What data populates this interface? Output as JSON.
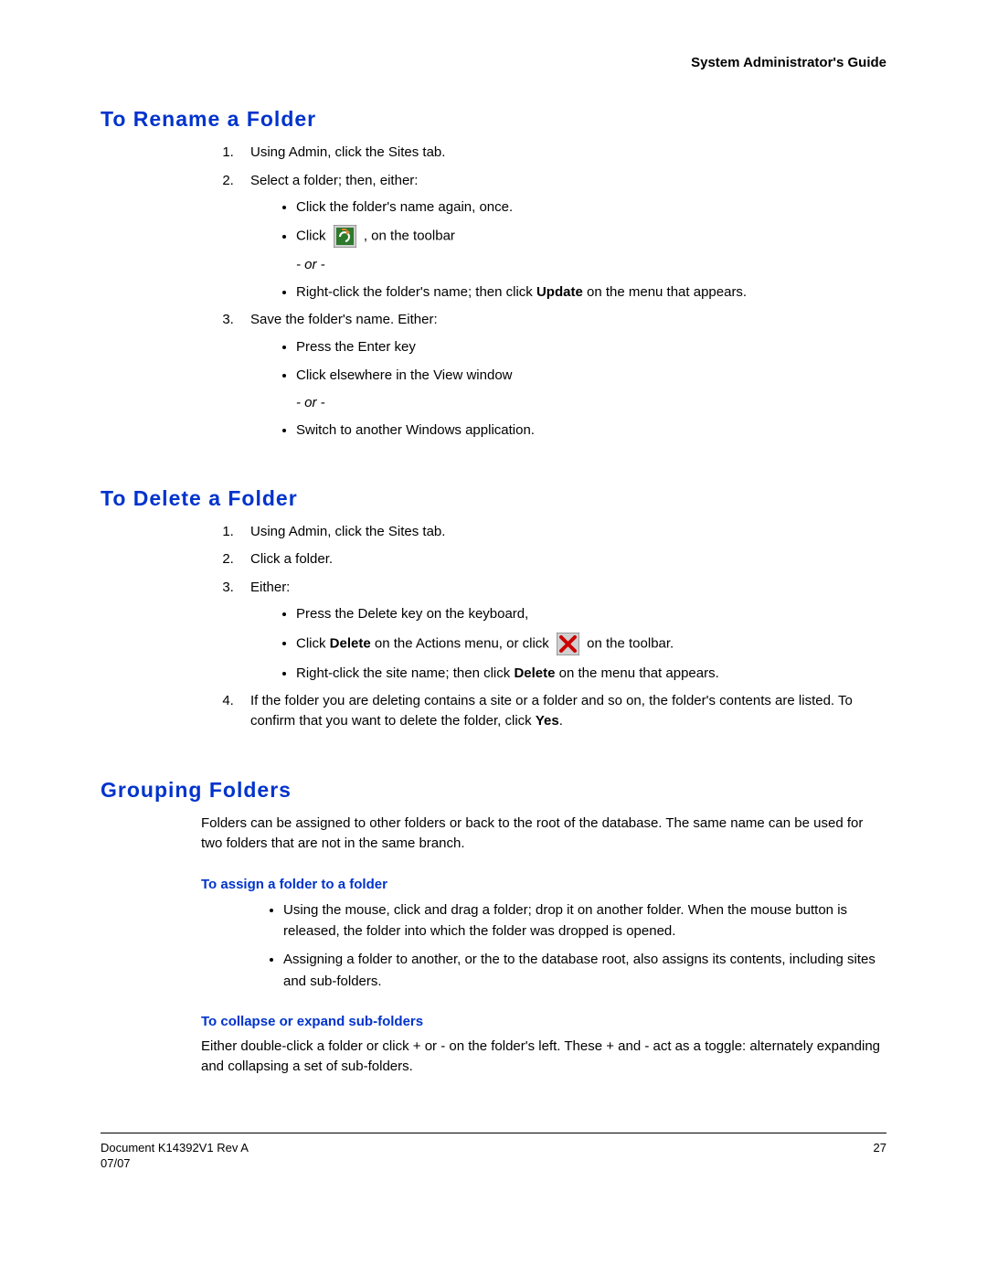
{
  "header": {
    "guide_title": "System Administrator's Guide"
  },
  "sections": {
    "rename": {
      "heading": "To Rename a Folder",
      "step1": "Using Admin, click the Sites tab.",
      "step2": "Select a folder; then, either:",
      "step2_b1": "Click the folder's name again, once.",
      "step2_b2_pre": "Click ",
      "step2_b2_post": " , on the toolbar",
      "step2_or": "- or -",
      "step2_b3_pre": "Right-click the folder's name; then click ",
      "step2_b3_bold": "Update",
      "step2_b3_post": " on the menu that appears.",
      "step3": "Save the folder's name. Either:",
      "step3_b1": "Press the Enter key",
      "step3_b2": "Click elsewhere in the View window",
      "step3_or": "- or -",
      "step3_b3": "Switch to another Windows application."
    },
    "delete": {
      "heading": "To Delete a Folder",
      "step1": "Using Admin, click the Sites tab.",
      "step2": "Click a folder.",
      "step3": "Either:",
      "step3_b1": "Press the Delete key on the keyboard,",
      "step3_b2_pre": "Click ",
      "step3_b2_bold1": "Delete",
      "step3_b2_mid": " on the Actions menu, or click ",
      "step3_b2_post": " on the toolbar.",
      "step3_b3_pre": "Right-click the site name; then click ",
      "step3_b3_bold": "Delete",
      "step3_b3_post": " on the menu that appears.",
      "step4_pre": "If the folder you are deleting contains a site or a folder and so on, the folder's contents are listed. To confirm that you want to delete the folder, click ",
      "step4_bold": "Yes",
      "step4_post": "."
    },
    "grouping": {
      "heading": "Grouping Folders",
      "intro": "Folders can be assigned to other folders or back to the root of the database. The same name can be used for two folders that are not in the same branch.",
      "sub1_title": "To assign a folder to a folder",
      "sub1_b1": "Using the mouse, click and drag a folder; drop it on another folder. When the mouse button is released, the folder into which the folder was dropped is opened.",
      "sub1_b2": "Assigning a folder to another, or the to the database root, also assigns its contents, including sites and sub-folders.",
      "sub2_title": "To collapse or expand sub-folders",
      "sub2_para": "Either double-click a folder or click + or - on the folder's left. These + and - act as a toggle: alternately expanding and collapsing a set of sub-folders."
    }
  },
  "footer": {
    "doc_id": "Document K14392V1 Rev A",
    "date": "07/07",
    "page_number": "27"
  }
}
